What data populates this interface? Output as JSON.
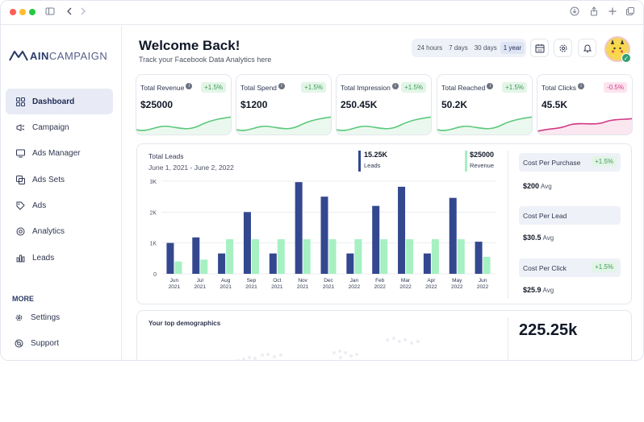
{
  "brand": {
    "main": "AIN",
    "sub": "CAMPAIGN"
  },
  "sidebar": {
    "items": [
      {
        "label": "Dashboard",
        "icon": "grid-icon"
      },
      {
        "label": "Campaign",
        "icon": "megaphone-icon"
      },
      {
        "label": "Ads Manager",
        "icon": "monitor-icon"
      },
      {
        "label": "Ads Sets",
        "icon": "layers-icon"
      },
      {
        "label": "Ads",
        "icon": "tag-icon"
      },
      {
        "label": "Analytics",
        "icon": "analytics-icon"
      },
      {
        "label": "Leads",
        "icon": "bar-chart-icon"
      }
    ],
    "more_label": "MORE",
    "more_items": [
      {
        "label": "Settings",
        "icon": "gear-icon"
      },
      {
        "label": "Support",
        "icon": "support-icon"
      }
    ]
  },
  "header": {
    "title": "Welcome Back!",
    "subtitle": "Track your Facebook Data Analytics here",
    "ranges": [
      "24 hours",
      "7 days",
      "30 days",
      "1 year"
    ],
    "selected_range": "1 year"
  },
  "kpis": [
    {
      "label": "Total Revenue",
      "value": "$25000",
      "change": "+1.5%",
      "trend": "up",
      "color": "#5cc97b"
    },
    {
      "label": "Total Spend",
      "value": "$1200",
      "change": "+1.5%",
      "trend": "up",
      "color": "#5cc97b"
    },
    {
      "label": "Total Impression",
      "value": "250.45K",
      "change": "+1.5%",
      "trend": "up",
      "color": "#5cc97b"
    },
    {
      "label": "Total Reached",
      "value": "50.2K",
      "change": "+1.5%",
      "trend": "up",
      "color": "#5cc97b"
    },
    {
      "label": "Total Clicks",
      "value": "45.5K",
      "change": "-0.5%",
      "trend": "down",
      "color": "#d23a85"
    }
  ],
  "leads_panel": {
    "title": "Total Leads",
    "date_range": "June 1, 2021 - June 2, 2022",
    "legend": [
      {
        "value": "15.25K",
        "label": "Leads",
        "color": "#34488f"
      },
      {
        "value": "$25000",
        "label": "Revenue",
        "color": "#a6f0c2"
      }
    ]
  },
  "chart_data": {
    "type": "bar",
    "categories": [
      "Jun 2021",
      "Jul 2021",
      "Aug 2021",
      "Sep 2021",
      "Oct 2021",
      "Nov 2021",
      "Dec 2021",
      "Jan 2022",
      "Feb 2022",
      "Mar 2022",
      "Apr 2022",
      "May 2022",
      "Jun 2022"
    ],
    "category_lines": [
      [
        "Jun",
        "2021"
      ],
      [
        "Jul",
        "2021"
      ],
      [
        "Aug",
        "2021"
      ],
      [
        "Sep",
        "2021"
      ],
      [
        "Oct",
        "2021"
      ],
      [
        "Nov",
        "2021"
      ],
      [
        "Dec",
        "2021"
      ],
      [
        "Jan",
        "2022"
      ],
      [
        "Feb",
        "2022"
      ],
      [
        "Mar",
        "2022"
      ],
      [
        "Apr",
        "2022"
      ],
      [
        "May",
        "2022"
      ],
      [
        "Jun",
        "2022"
      ]
    ],
    "series": [
      {
        "name": "Leads",
        "color": "#34488f",
        "values": [
          1000,
          1180,
          660,
          2000,
          660,
          2970,
          2500,
          660,
          2200,
          2820,
          660,
          2460,
          1040
        ]
      },
      {
        "name": "Revenue",
        "color": "#a6f0c2",
        "values": [
          400,
          460,
          1120,
          1120,
          1120,
          1120,
          1120,
          1120,
          1120,
          1120,
          1120,
          1120,
          550
        ]
      }
    ],
    "yticks": [
      "0",
      "1K",
      "2K",
      "3K"
    ],
    "ylim": [
      0,
      3000
    ],
    "grid": true
  },
  "costs": [
    {
      "label": "Cost Per Purchase",
      "badge": "+1.5%",
      "value": "$200",
      "unit": "Avg"
    },
    {
      "label": "Cost Per Lead",
      "badge": "",
      "value": "$30.5",
      "unit": "Avg"
    },
    {
      "label": "Cost Per Click",
      "badge": "+1.5%",
      "value": "$25.9",
      "unit": "Avg"
    }
  ],
  "demographics": {
    "title": "Your top demographics",
    "total": "225.25k"
  }
}
